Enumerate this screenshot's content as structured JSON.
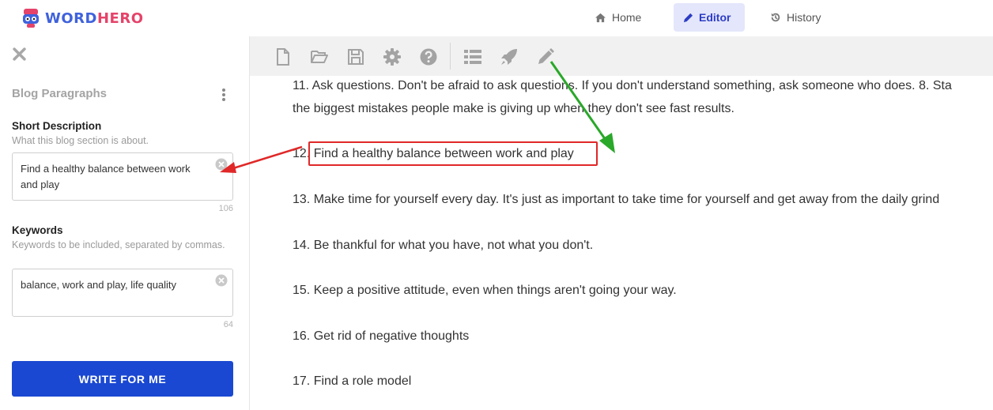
{
  "header": {
    "logo_word": "WORD",
    "logo_hero": "HERO",
    "nav": [
      {
        "label": "Home",
        "icon": "home-icon",
        "active": false
      },
      {
        "label": "Editor",
        "icon": "pencil-icon",
        "active": true
      },
      {
        "label": "History",
        "icon": "history-icon",
        "active": false
      }
    ]
  },
  "toolbar": {
    "icons": [
      "new-file-icon",
      "open-folder-icon",
      "save-icon",
      "settings-gear-icon",
      "help-icon",
      "list-icon",
      "rocket-icon",
      "pencil-icon"
    ]
  },
  "sidebar": {
    "section_title": "Blog Paragraphs",
    "short_description": {
      "label": "Short Description",
      "help": "What this blog section is about.",
      "value": "Find a healthy balance between work and play",
      "count": "106"
    },
    "keywords": {
      "label": "Keywords",
      "help": "Keywords to be included, separated by commas.",
      "value": "balance, work and play, life quality",
      "count": "64"
    },
    "write_button": "WRITE FOR ME"
  },
  "editor": {
    "paragraphs": [
      "11. Ask questions. Don't be afraid to ask questions. If you don't understand something, ask someone who does. 8. Sta",
      "the biggest mistakes people make is giving up when they don't see fast results.",
      "12. Find a healthy balance between work and play",
      "13. Make time for yourself every day. It's just as important to take time for yourself and get away from the daily grind",
      "14. Be thankful for what you have, not what you don't.",
      "15. Keep a positive attitude, even when things aren't going your way.",
      "16. Get rid of negative thoughts",
      "17. Find a role model"
    ]
  },
  "colors": {
    "accent": "#1a48d2",
    "nav_active_bg": "#e4e6fb",
    "highlight_red": "#e02828",
    "arrow_green": "#2aa82a"
  }
}
